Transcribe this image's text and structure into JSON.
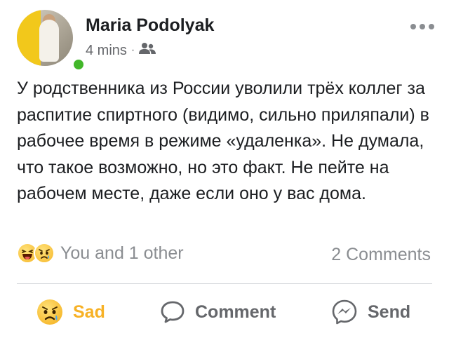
{
  "post": {
    "author": "Maria Podolyak",
    "time": "4 mins",
    "separator": "·",
    "audience_icon": "friends-icon",
    "online": true,
    "text": "У родственника из России уволили трёх коллег за распитие спиртного (видимо, сильно приляпали) в рабочее время в режиме «удаленка». Не думала, что такое возможно, но это факт. Не пейте на рабочем месте, даже если оно у вас дома."
  },
  "reactions": {
    "icons": [
      "haha-reaction-icon",
      "sad-reaction-icon"
    ],
    "summary": "You and 1 other",
    "comments": "2 Comments"
  },
  "actions": {
    "react_label": "Sad",
    "comment_label": "Comment",
    "send_label": "Send"
  },
  "colors": {
    "text": "#1c1e21",
    "muted": "#65676b",
    "online": "#42b72a",
    "sad": "#f7b125",
    "divider": "#d6d8dc"
  }
}
